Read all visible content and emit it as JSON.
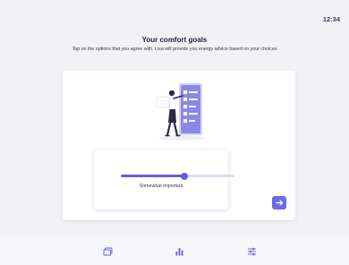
{
  "status_bar": {
    "time": "12:34"
  },
  "header": {
    "title": "Your comfort goals",
    "subtitle": "Tap on the options that you agree with. Lisa will provide you energy advice based on your choices"
  },
  "slider": {
    "level": 0.56,
    "label": "Somewhat important"
  },
  "colors": {
    "accent": "#6461d6",
    "track": "#dcdcee",
    "background": "#f2f2f6",
    "card": "#ffffff"
  },
  "icons": {
    "next": "arrow-right-icon",
    "nav_left": "cards-icon",
    "nav_center": "bar-chart-icon",
    "nav_right": "sliders-icon"
  }
}
